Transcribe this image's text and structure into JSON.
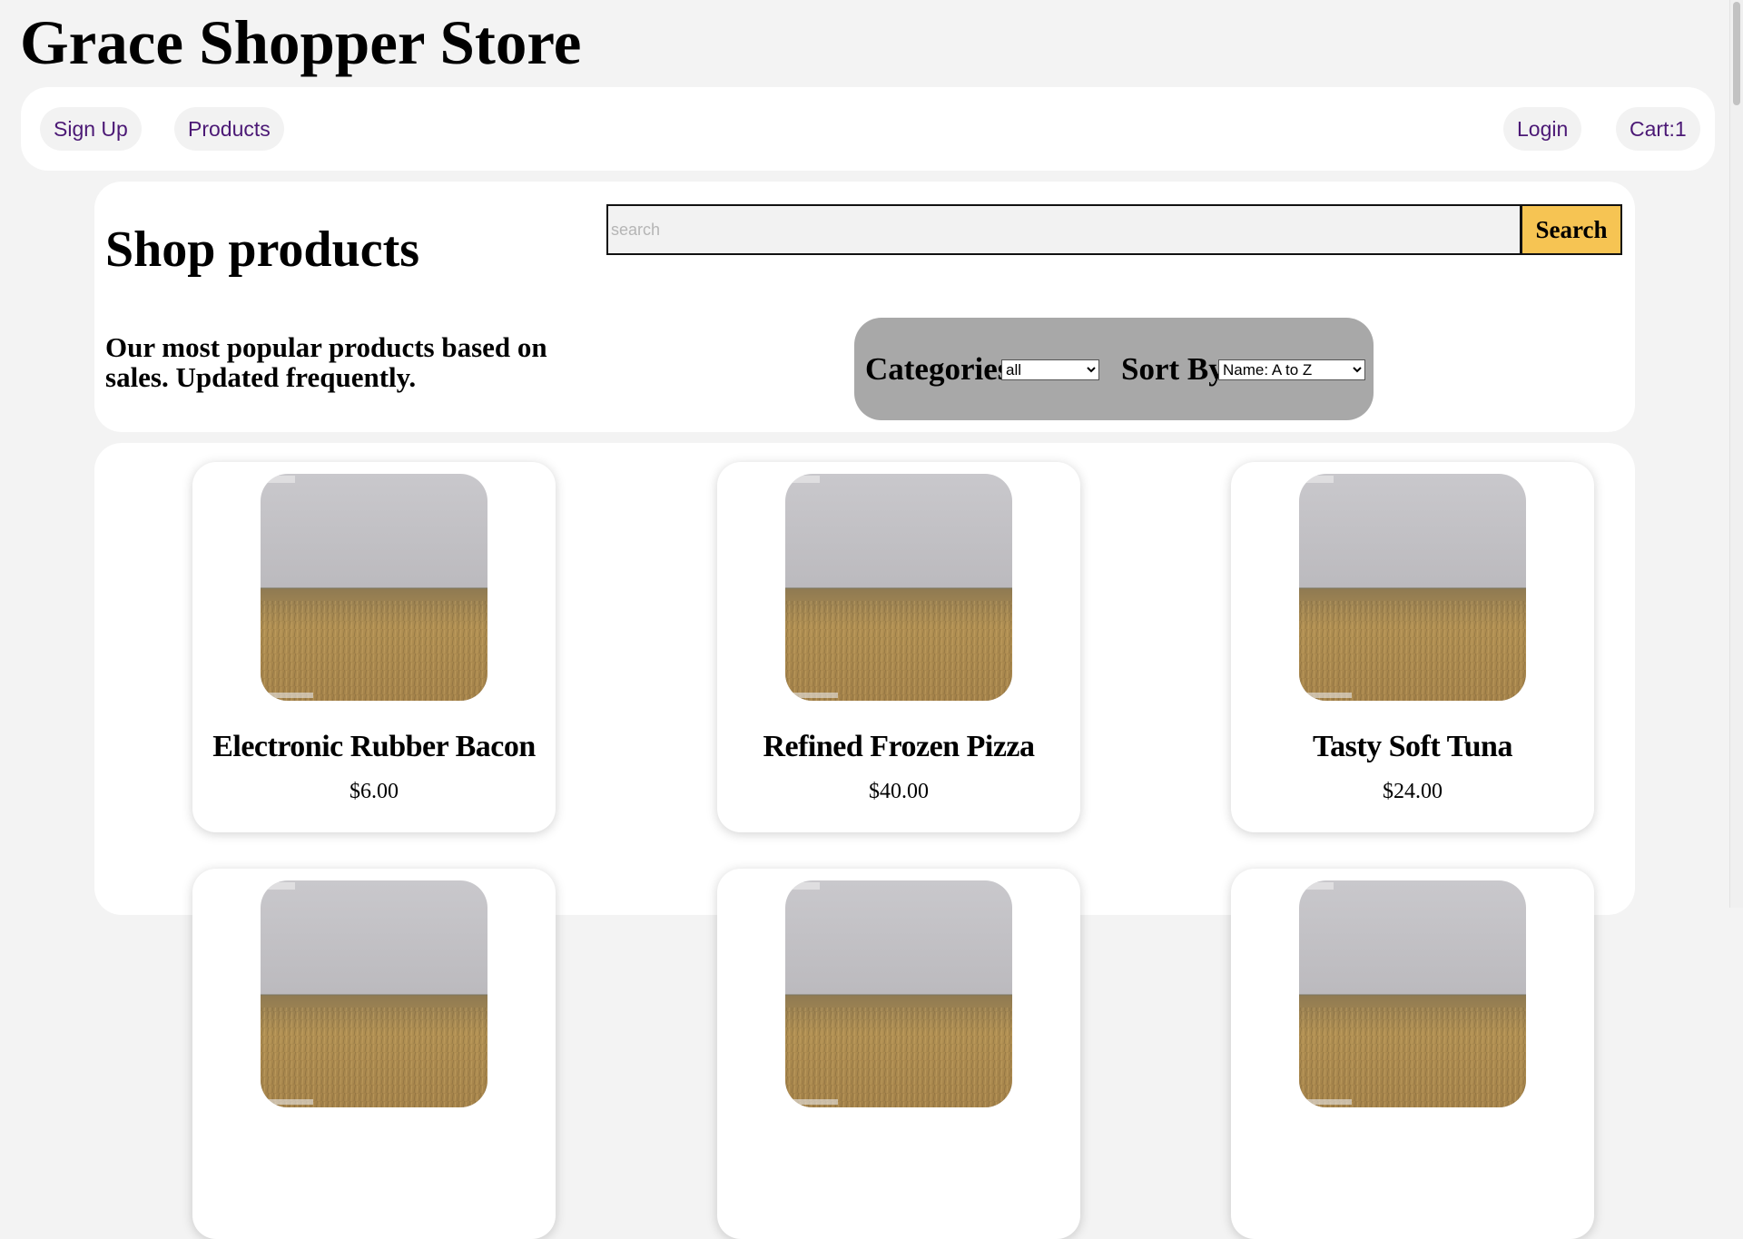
{
  "site": {
    "title": "Grace Shopper Store"
  },
  "nav": {
    "sign_up": "Sign Up",
    "products": "Products",
    "login": "Login",
    "cart": "Cart:1"
  },
  "shop": {
    "heading": "Shop products",
    "tagline": "Our most popular products based on sales. Updated frequently.",
    "search_placeholder": "search",
    "search_value": "",
    "search_button": "Search"
  },
  "filters": {
    "categories_label": "Categories:",
    "categories_selected": "all",
    "sort_label": "Sort By:",
    "sort_selected": "Name: A to Z"
  },
  "products": [
    {
      "name": "Electronic Rubber Bacon",
      "price": "$6.00",
      "image": "wheat-field-photo"
    },
    {
      "name": "Refined Frozen Pizza",
      "price": "$40.00",
      "image": "wheat-field-photo"
    },
    {
      "name": "Tasty Soft Tuna",
      "price": "$24.00",
      "image": "wheat-field-photo"
    },
    {
      "name": "",
      "price": "",
      "image": "wheat-field-photo"
    },
    {
      "name": "",
      "price": "",
      "image": "wheat-field-photo"
    },
    {
      "name": "",
      "price": "",
      "image": "wheat-field-photo"
    }
  ],
  "colors": {
    "page_bg": "#f3f3f3",
    "nav_link_text": "#4b1875",
    "search_button_bg": "#f6c453",
    "filter_bar_bg": "#a8a8a8"
  }
}
